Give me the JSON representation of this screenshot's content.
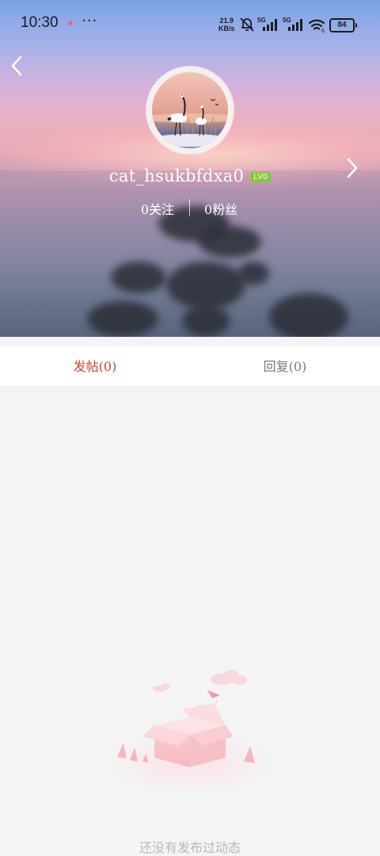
{
  "status_bar": {
    "time": "10:30",
    "more": "···",
    "net_speed_value": "21.9",
    "net_speed_unit": "KB/s",
    "signal_1_label": "5G",
    "signal_2_label": "5G",
    "wifi_sub": "6",
    "battery": "84"
  },
  "profile": {
    "username": "cat_hsukbfdxa0",
    "level": "LV0",
    "following": "0关注",
    "fans": "0粉丝"
  },
  "tabs": [
    {
      "label": "发帖(0)",
      "active": true
    },
    {
      "label": "回复(0)",
      "active": false
    }
  ],
  "empty_state": {
    "text": "还没有发布过动态"
  },
  "colors": {
    "accent": "#d2432f",
    "level_badge": "#8ac43f",
    "tab_inactive": "#7a7a7a",
    "background": "#f4f4f4"
  },
  "icons": {
    "back": "chevron-left-icon",
    "next": "chevron-right-icon"
  }
}
